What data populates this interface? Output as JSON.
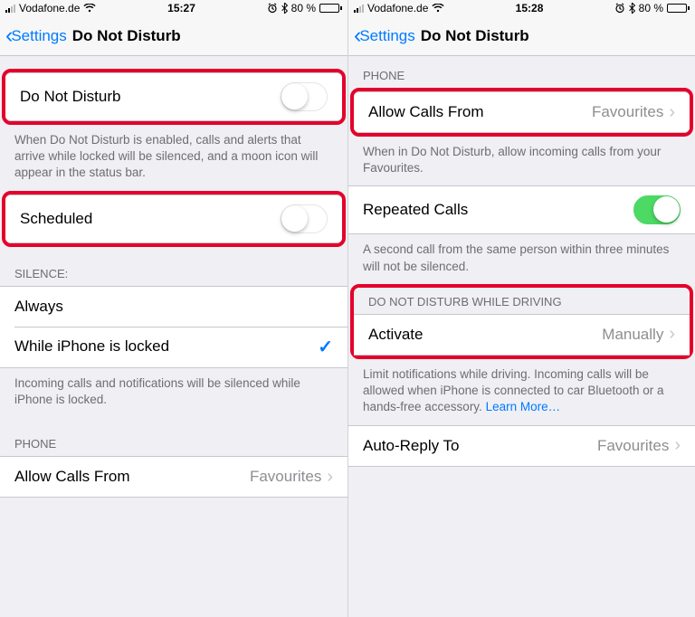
{
  "left": {
    "status": {
      "carrier": "Vodafone.de",
      "time": "15:27",
      "battery_pct": "80 %"
    },
    "nav": {
      "back": "Settings",
      "title": "Do Not Disturb"
    },
    "dnd": {
      "label": "Do Not Disturb",
      "footer": "When Do Not Disturb is enabled, calls and alerts that arrive while locked will be silenced, and a moon icon will appear in the status bar."
    },
    "scheduled": {
      "label": "Scheduled"
    },
    "silence": {
      "header": "SILENCE:",
      "always": "Always",
      "locked": "While iPhone is locked",
      "footer": "Incoming calls and notifications will be silenced while iPhone is locked."
    },
    "phone": {
      "header": "PHONE",
      "allow_label": "Allow Calls From",
      "allow_value": "Favourites"
    }
  },
  "right": {
    "status": {
      "carrier": "Vodafone.de",
      "time": "15:28",
      "battery_pct": "80 %"
    },
    "nav": {
      "back": "Settings",
      "title": "Do Not Disturb"
    },
    "phone": {
      "header": "PHONE",
      "allow_label": "Allow Calls From",
      "allow_value": "Favourites",
      "allow_footer": "When in Do Not Disturb, allow incoming calls from your Favourites."
    },
    "repeated": {
      "label": "Repeated Calls",
      "footer": "A second call from the same person within three minutes will not be silenced."
    },
    "driving": {
      "header": "DO NOT DISTURB WHILE DRIVING",
      "activate_label": "Activate",
      "activate_value": "Manually",
      "footer_text": "Limit notifications while driving. Incoming calls will be allowed when iPhone is connected to car Bluetooth or a hands-free accessory. ",
      "learn_more": "Learn More…"
    },
    "autoreply": {
      "label": "Auto-Reply To",
      "value": "Favourites"
    }
  }
}
